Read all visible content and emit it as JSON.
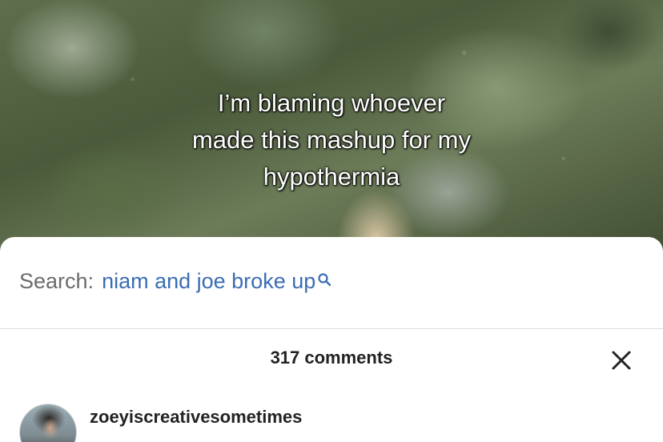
{
  "video": {
    "caption": "I’m blaming whoever\nmade this mashup for my\nhypothermia"
  },
  "search": {
    "prefix": "Search:",
    "query": "niam and joe broke up",
    "icon": "search-icon"
  },
  "comments": {
    "header": "317 comments",
    "close_icon": "close-icon",
    "items": [
      {
        "username": "zoeyiscreativesometimes"
      }
    ]
  },
  "colors": {
    "search_query": "#3a6db5",
    "search_prefix": "#6b6b6b",
    "sheet_bg": "#ffffff"
  }
}
